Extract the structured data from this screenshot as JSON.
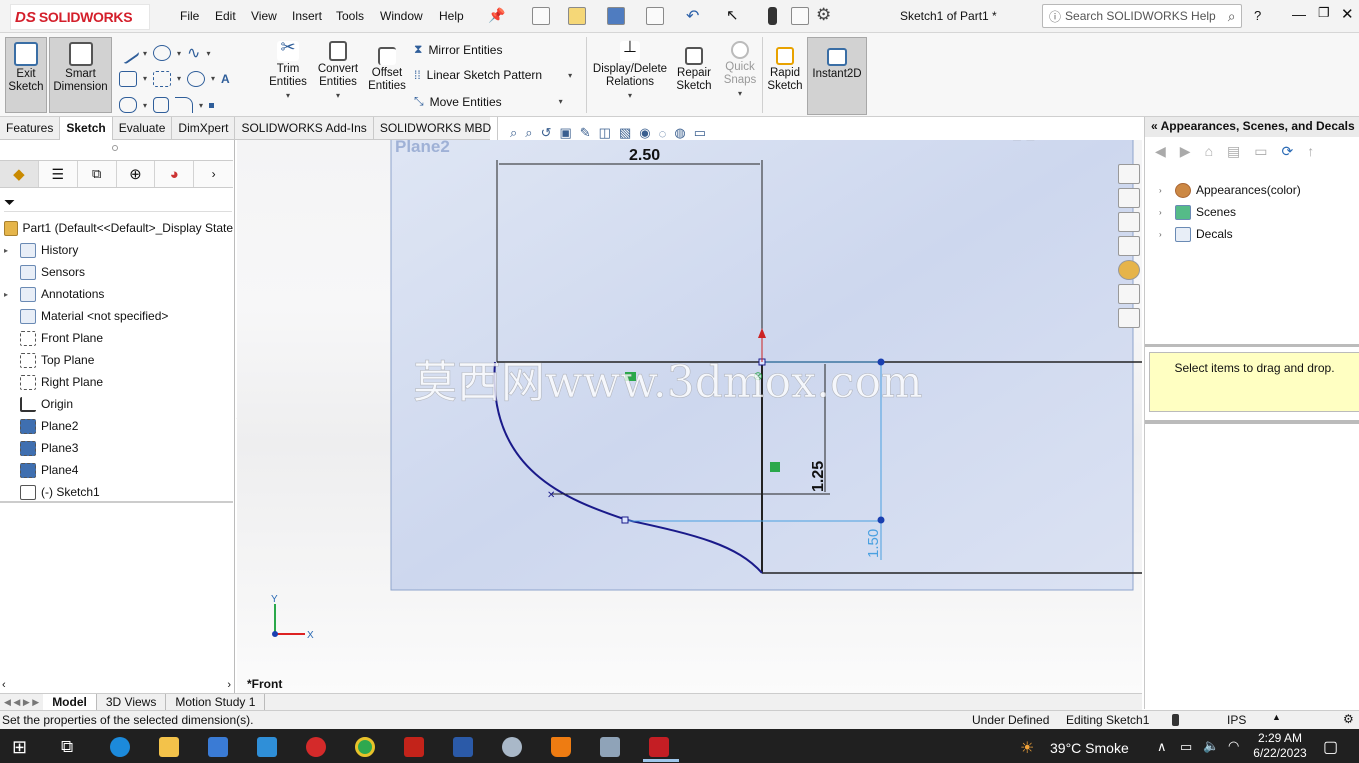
{
  "app": {
    "logo_text": "SOLIDWORKS",
    "title": "Sketch1 of Part1 *",
    "search_placeholder": "Search SOLIDWORKS Help"
  },
  "menu": [
    "File",
    "Edit",
    "View",
    "Insert",
    "Tools",
    "Window",
    "Help"
  ],
  "commands": {
    "exit_sketch": "Exit Sketch",
    "smart_dimension": "Smart Dimension",
    "trim_entities": "Trim Entities",
    "convert_entities": "Convert Entities",
    "offset_entities": "Offset Entities",
    "mirror_entities": "Mirror Entities",
    "linear_sketch_pattern": "Linear Sketch Pattern",
    "move_entities": "Move Entities",
    "display_delete_relations": "Display/Delete Relations",
    "repair_sketch": "Repair Sketch",
    "quick_snaps": "Quick Snaps",
    "rapid_sketch": "Rapid Sketch",
    "instant2d": "Instant2D"
  },
  "tabs": [
    "Features",
    "Sketch",
    "Evaluate",
    "DimXpert",
    "SOLIDWORKS Add-Ins",
    "SOLIDWORKS MBD"
  ],
  "active_tab": "Sketch",
  "tree": [
    {
      "label": "Part1  (Default<<Default>_Display State",
      "icon": "part-icon",
      "arrow": false
    },
    {
      "label": "History",
      "icon": "history-icon",
      "arrow": true
    },
    {
      "label": "Sensors",
      "icon": "sensors-icon",
      "arrow": false
    },
    {
      "label": "Annotations",
      "icon": "annotations-icon",
      "arrow": true
    },
    {
      "label": "Material <not specified>",
      "icon": "material-icon",
      "arrow": false
    },
    {
      "label": "Front Plane",
      "icon": "plane-icon",
      "arrow": false
    },
    {
      "label": "Top Plane",
      "icon": "plane-icon",
      "arrow": false
    },
    {
      "label": "Right Plane",
      "icon": "plane-icon",
      "arrow": false
    },
    {
      "label": "Origin",
      "icon": "origin-icon",
      "arrow": false
    },
    {
      "label": "Plane2",
      "icon": "plane-icon",
      "arrow": false
    },
    {
      "label": "Plane3",
      "icon": "plane-icon",
      "arrow": false
    },
    {
      "label": "Plane4",
      "icon": "plane-icon",
      "arrow": false
    },
    {
      "label": "(-) Sketch1",
      "icon": "sketch-icon",
      "arrow": false
    }
  ],
  "viewport": {
    "plane_label": "Plane2",
    "dim_width": "2.50",
    "dim_height_1": "1.25",
    "dim_height_2": "1.50",
    "view_label": "*Front",
    "watermark": "莫西网www.3dmox.com",
    "axis_y": "Y",
    "axis_x": "X"
  },
  "right_panel": {
    "title": "Appearances, Scenes, and Decals",
    "items": [
      "Appearances(color)",
      "Scenes",
      "Decals"
    ],
    "hint": "Select items to drag and drop."
  },
  "bottom_tabs": [
    "Model",
    "3D Views",
    "Motion Study 1"
  ],
  "status": {
    "message": "Set the properties of the selected dimension(s).",
    "state": "Under Defined",
    "mode": "Editing Sketch1",
    "units": "IPS"
  },
  "taskbar": {
    "weather": "39°C  Smoke",
    "time": "2:29 AM",
    "date": "6/22/2023"
  }
}
